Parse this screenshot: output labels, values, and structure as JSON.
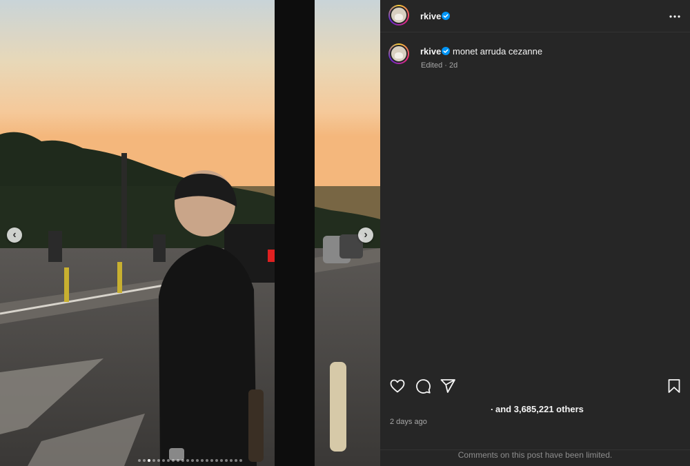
{
  "post": {
    "author": {
      "username": "rkive",
      "verified": true,
      "avatar": "avatar-icon"
    },
    "caption": {
      "username": "rkive",
      "text": "monet arruda cezanne",
      "meta": "Edited · 2d"
    },
    "likes": {
      "prefix": ".",
      "text": "and 3,685,221 others"
    },
    "posted": "2 days ago",
    "comments_notice": "Comments on this post have been limited.",
    "carousel": {
      "slides": 22,
      "active_index": 2
    }
  },
  "icons": {
    "more": "more-horizontal-icon",
    "like": "heart-icon",
    "comment": "comment-bubble-icon",
    "share": "send-paper-plane-icon",
    "save": "bookmark-icon",
    "prev": "chevron-left-icon",
    "next": "chevron-right-icon",
    "verified": "verified-badge-icon"
  },
  "colors": {
    "verified": "#0095f6",
    "panel_bg": "#262626",
    "muted_text": "#a8a8a8"
  },
  "nav": {
    "prev_glyph": "‹",
    "next_glyph": "›"
  }
}
